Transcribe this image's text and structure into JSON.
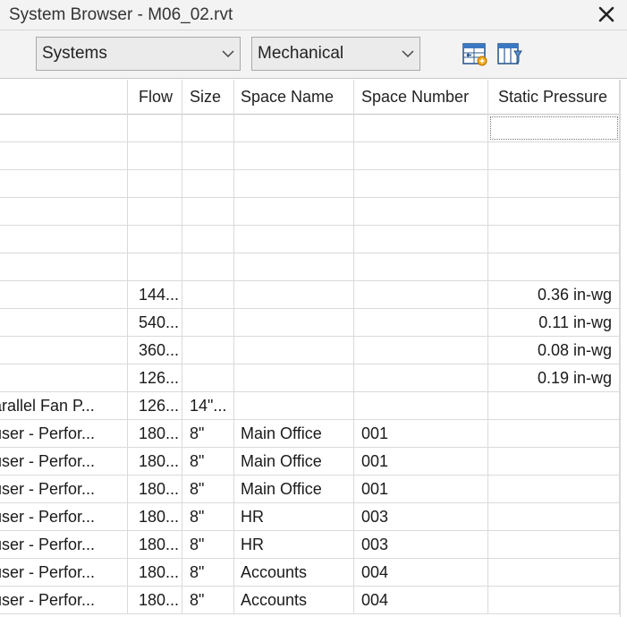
{
  "window": {
    "title": "System Browser - M06_02.rvt",
    "close_icon": "close-icon"
  },
  "toolbar": {
    "view_dropdown": "Systems",
    "discipline_dropdown": "Mechanical",
    "autofit_icon": "autofit-columns-icon",
    "column_settings_icon": "column-settings-icon"
  },
  "columns": [
    "",
    "Flow",
    "Size",
    "Space Name",
    "Space Number",
    "Static Pressure"
  ],
  "rows": [
    [
      "",
      "",
      "",
      "",
      "",
      ""
    ],
    [
      "",
      "",
      "",
      "",
      "",
      ""
    ],
    [
      "",
      "",
      "",
      "",
      "",
      ""
    ],
    [
      "",
      "",
      "",
      "",
      "",
      ""
    ],
    [
      "",
      "",
      "",
      "",
      "",
      ""
    ],
    [
      "",
      "",
      "",
      "",
      "",
      ""
    ],
    [
      "",
      "144...",
      "",
      "",
      "",
      "0.36 in-wg"
    ],
    [
      "",
      "540...",
      "",
      "",
      "",
      "0.11 in-wg"
    ],
    [
      "",
      "360...",
      "",
      "",
      "",
      "0.08 in-wg"
    ],
    [
      "",
      "126...",
      "",
      "",
      "",
      "0.19 in-wg"
    ],
    [
      "arallel Fan P...",
      "126...",
      "14\"...",
      "",
      "",
      ""
    ],
    [
      "user - Perfor...",
      "180...",
      "8\"",
      "Main Office",
      "001",
      ""
    ],
    [
      "user - Perfor...",
      "180...",
      "8\"",
      "Main Office",
      "001",
      ""
    ],
    [
      "user - Perfor...",
      "180...",
      "8\"",
      "Main Office",
      "001",
      ""
    ],
    [
      "user - Perfor...",
      "180...",
      "8\"",
      "HR",
      "003",
      ""
    ],
    [
      "user - Perfor...",
      "180...",
      "8\"",
      "HR",
      "003",
      ""
    ],
    [
      "user - Perfor...",
      "180...",
      "8\"",
      "Accounts",
      "004",
      ""
    ],
    [
      "user - Perfor...",
      "180...",
      "8\"",
      "Accounts",
      "004",
      ""
    ]
  ]
}
